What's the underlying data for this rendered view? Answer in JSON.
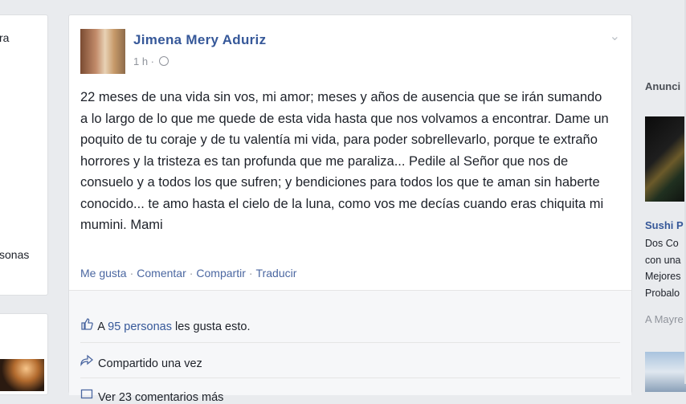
{
  "left_card": {
    "line1": "ra",
    "line2": "sonas"
  },
  "post": {
    "author": "Jimena Mery Aduriz",
    "time": "1 h ·",
    "privacy_icon": "globe-icon",
    "menu_icon": "chevron-down-icon",
    "text": "22 meses de una vida sin vos, mi amor; meses y años de ausencia que se irán sumando a lo largo de lo que me quede de esta vida hasta que nos volvamos a encontrar. Dame un poquito de tu coraje y de tu valentía mi vida, para poder sobrellevarlo, porque te extraño horrores y la tristeza es tan profunda que me paraliza... Pedile al Señor que nos de consuelo y a todos los que sufren; y bendiciones para todos los que te aman sin haberte conocido... te amo hasta el cielo de la luna, como vos me decías cuando eras chiquita mi mumini. Mami",
    "actions": {
      "like": "Me gusta",
      "comment": "Comentar",
      "share": "Compartir",
      "translate": "Traducir"
    },
    "likes_prefix": "A",
    "likes_link": "95 personas",
    "likes_suffix": "les gusta esto.",
    "shared": "Compartido una vez",
    "comments": "Ver 23 comentarios más"
  },
  "ads": {
    "header": "Anunci",
    "title": "Sushi P",
    "desc_lines": [
      "Dos Co",
      "con una",
      "Mejores",
      "Probalo"
    ],
    "more": "A Mayre"
  },
  "colors": {
    "link": "#365899",
    "background": "#e9ebee"
  }
}
